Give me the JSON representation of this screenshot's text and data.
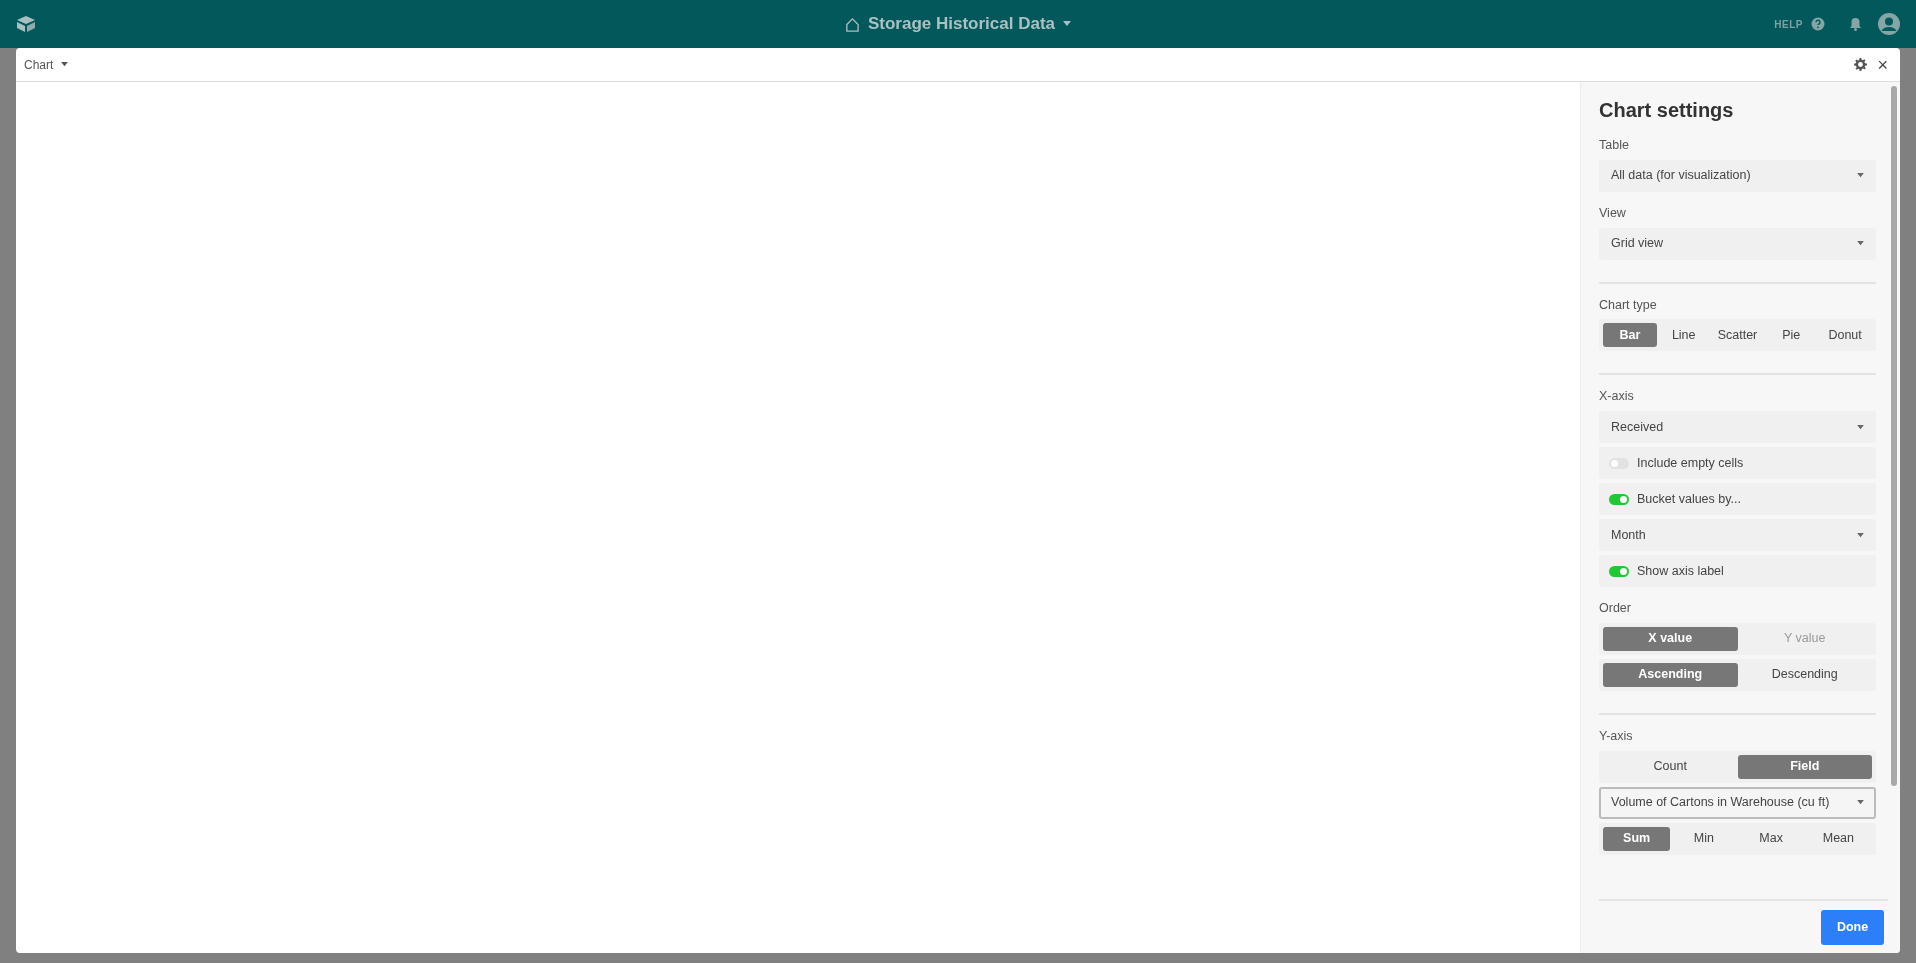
{
  "top_bar": {
    "title": "Storage Historical Data",
    "help": "HELP"
  },
  "modal": {
    "title": "Chart",
    "close": "×"
  },
  "settings": {
    "heading": "Chart settings",
    "rows": [
      {
        "kind": "label",
        "text": "Table"
      },
      {
        "kind": "select",
        "value": "All data (for visualization)",
        "focused": false
      },
      {
        "kind": "label",
        "text": "View"
      },
      {
        "kind": "select",
        "value": "Grid view",
        "focused": false
      },
      {
        "kind": "divider"
      },
      {
        "kind": "label",
        "text": "Chart type"
      },
      {
        "kind": "segmented",
        "options": [
          {
            "label": "Bar",
            "selected": true,
            "disabled": false
          },
          {
            "label": "Line",
            "selected": false,
            "disabled": false
          },
          {
            "label": "Scatter",
            "selected": false,
            "disabled": false
          },
          {
            "label": "Pie",
            "selected": false,
            "disabled": false
          },
          {
            "label": "Donut",
            "selected": false,
            "disabled": false
          }
        ]
      },
      {
        "kind": "divider"
      },
      {
        "kind": "label",
        "text": "X-axis"
      },
      {
        "kind": "select",
        "value": "Received",
        "focused": false
      },
      {
        "kind": "toggle",
        "text": "Include empty cells",
        "on": false
      },
      {
        "kind": "toggle",
        "text": "Bucket values by...",
        "on": true
      },
      {
        "kind": "select",
        "value": "Month",
        "focused": false
      },
      {
        "kind": "toggle",
        "text": "Show axis label",
        "on": true
      },
      {
        "kind": "label",
        "text": "Order"
      },
      {
        "kind": "segmented",
        "options": [
          {
            "label": "X value",
            "selected": true,
            "disabled": false
          },
          {
            "label": "Y value",
            "selected": false,
            "disabled": true
          }
        ]
      },
      {
        "kind": "segmented",
        "options": [
          {
            "label": "Ascending",
            "selected": true,
            "disabled": false
          },
          {
            "label": "Descending",
            "selected": false,
            "disabled": false
          }
        ]
      },
      {
        "kind": "divider"
      },
      {
        "kind": "label",
        "text": "Y-axis"
      },
      {
        "kind": "segmented",
        "options": [
          {
            "label": "Count",
            "selected": false,
            "disabled": false
          },
          {
            "label": "Field",
            "selected": true,
            "disabled": false
          }
        ]
      },
      {
        "kind": "select",
        "value": "Volume of Cartons in Warehouse (cu ft)",
        "focused": true
      },
      {
        "kind": "segmented",
        "options": [
          {
            "label": "Sum",
            "selected": true,
            "disabled": false
          },
          {
            "label": "Min",
            "selected": false,
            "disabled": false
          },
          {
            "label": "Max",
            "selected": false,
            "disabled": false
          },
          {
            "label": "Mean",
            "selected": false,
            "disabled": false
          }
        ]
      }
    ],
    "done": "Done"
  }
}
